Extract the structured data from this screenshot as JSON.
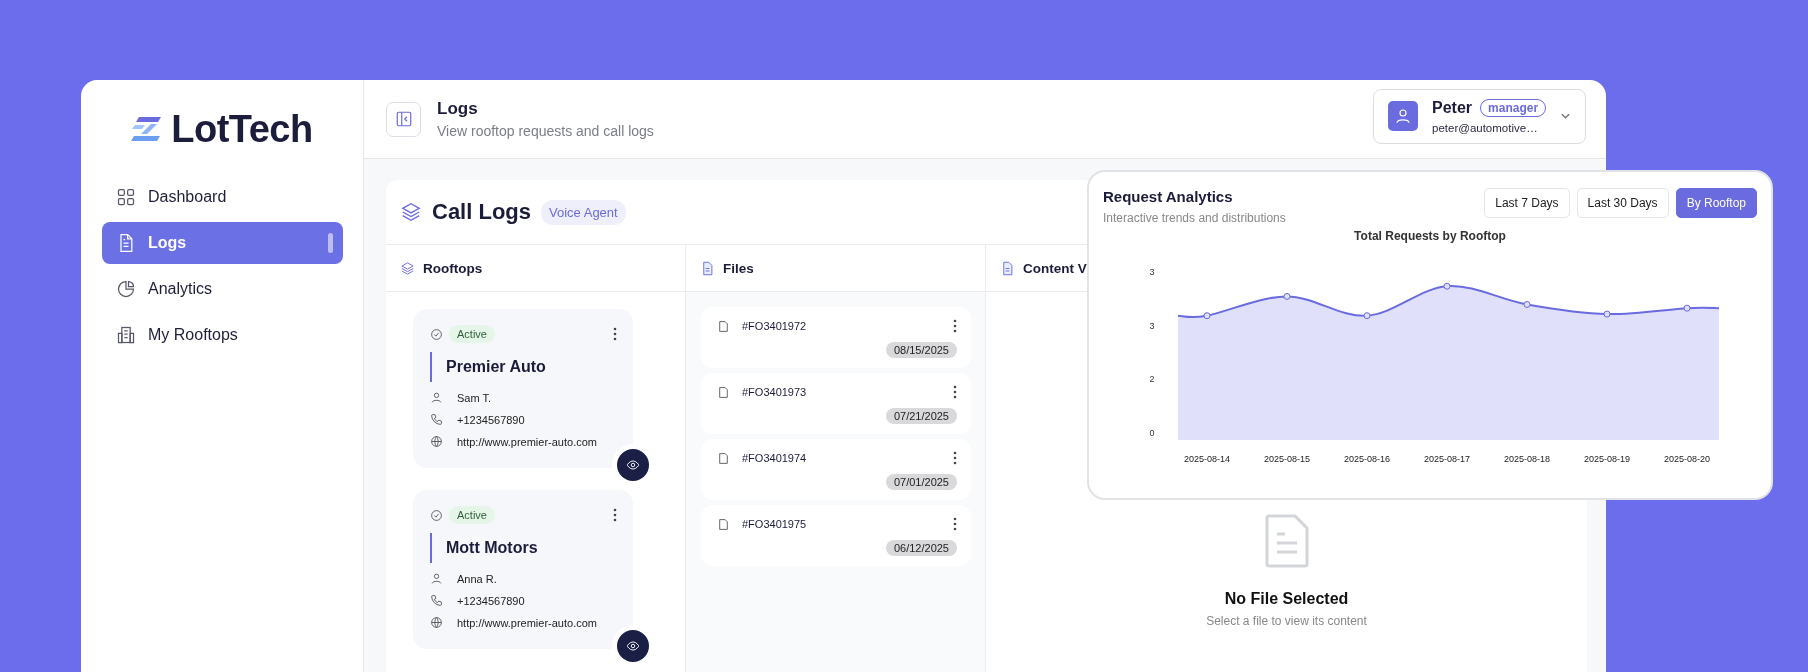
{
  "brand": {
    "name": "LotTech"
  },
  "nav": [
    {
      "label": "Dashboard",
      "selected": false
    },
    {
      "label": "Logs",
      "selected": true
    },
    {
      "label": "Analytics",
      "selected": false
    },
    {
      "label": "My Rooftops",
      "selected": false
    }
  ],
  "header": {
    "title": "Logs",
    "subtitle": "View rooftop requests and call logs"
  },
  "user": {
    "name": "Peter",
    "role": "manager",
    "email": "peter@automotive…"
  },
  "call_logs": {
    "title": "Call Logs",
    "badge": "Voice Agent",
    "columns": [
      {
        "label": "Rooftops"
      },
      {
        "label": "Files"
      },
      {
        "label": "Content V"
      }
    ]
  },
  "rooftops": [
    {
      "status": "Active",
      "name": "Premier Auto",
      "contact": "Sam T.",
      "phone": "+1234567890",
      "website": "http://www.premier-auto.com"
    },
    {
      "status": "Active",
      "name": "Mott Motors",
      "contact": "Anna R.",
      "phone": "+1234567890",
      "website": "http://www.premier-auto.com"
    }
  ],
  "files": [
    {
      "id": "#FO3401972",
      "date": "08/15/2025"
    },
    {
      "id": "#FO3401973",
      "date": "07/21/2025"
    },
    {
      "id": "#FO3401974",
      "date": "07/01/2025"
    },
    {
      "id": "#FO3401975",
      "date": "06/12/2025"
    }
  ],
  "viewer": {
    "title": "No File Selected",
    "subtitle": "Select a file to view its content"
  },
  "analytics": {
    "title": "Request Analytics",
    "subtitle": "Interactive trends and distributions",
    "ranges": [
      {
        "label": "Last 7 Days",
        "selected": false
      },
      {
        "label": "Last 30 Days",
        "selected": false
      },
      {
        "label": "By Rooftop",
        "selected": true
      }
    ],
    "chart": {
      "title": "Total Requests by Rooftop",
      "x_labels": [
        "2025-08-14",
        "2025-08-15",
        "2025-08-16",
        "2025-08-17",
        "2025-08-18",
        "2025-08-19",
        "2025-08-20"
      ],
      "y_labels": [
        "3",
        "3",
        "2",
        "0"
      ]
    }
  }
}
